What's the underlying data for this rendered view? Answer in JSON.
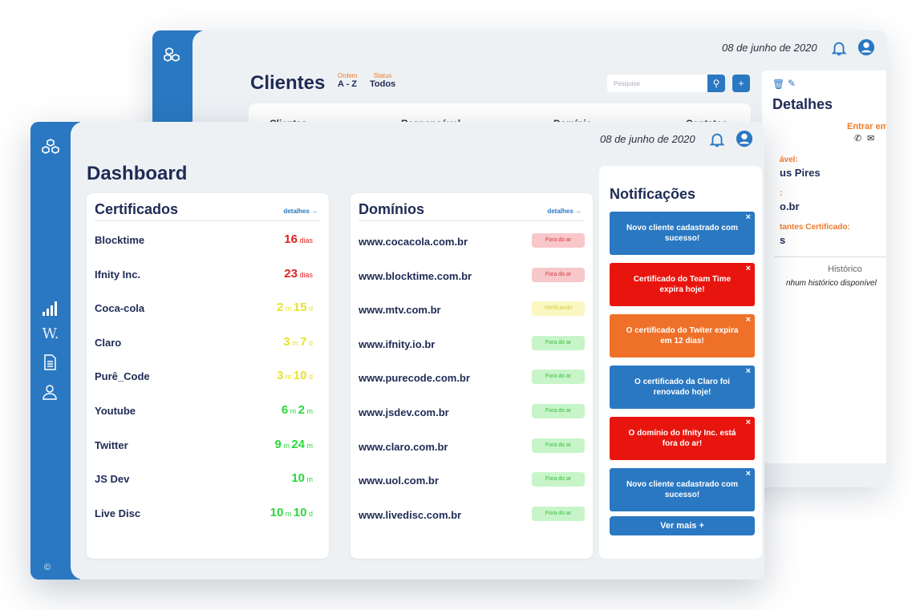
{
  "back": {
    "date": "08 de junho de 2020",
    "title": "Clientes",
    "order_label": "Ordem",
    "order_value": "A - Z",
    "status_label": "Status",
    "status_value": "Todos",
    "search_placeholder": "Pesquise",
    "table_headers": [
      "Clientes",
      "Responsável",
      "Domínio",
      "Contatos"
    ],
    "details": {
      "title": "Detalhes",
      "contact": "Entrar em contato",
      "resp_label": "ável:",
      "resp_value": "us Pires",
      "domain_label": ":",
      "domain_value": "o.br",
      "remaining_label": "tantes Certificado:",
      "remaining_value": "s",
      "history_label": "Histórico",
      "history_empty": "nhum histórico disponível"
    }
  },
  "front": {
    "date": "08 de junho de 2020",
    "title": "Dashboard",
    "copyright": "©",
    "certificates": {
      "title": "Certificados",
      "link": "detalhes →",
      "rows": [
        {
          "name": "Blocktime",
          "parts": [
            [
              "16",
              " dias"
            ]
          ],
          "color": "#e0231f"
        },
        {
          "name": "Ifnity Inc.",
          "parts": [
            [
              "23",
              " dias"
            ]
          ],
          "color": "#e0231f"
        },
        {
          "name": "Coca-cola",
          "parts": [
            [
              "2",
              " m "
            ],
            [
              "15",
              " d"
            ]
          ],
          "color": "#e9e22a"
        },
        {
          "name": "Claro",
          "parts": [
            [
              "3",
              " m "
            ],
            [
              "7",
              " d"
            ]
          ],
          "color": "#e9e22a"
        },
        {
          "name": "Purê_Code",
          "parts": [
            [
              "3",
              " m "
            ],
            [
              "10",
              " d"
            ]
          ],
          "color": "#e9e22a"
        },
        {
          "name": "Youtube",
          "parts": [
            [
              "6",
              " m "
            ],
            [
              "2",
              " m"
            ]
          ],
          "color": "#2bd83a"
        },
        {
          "name": "Twitter",
          "parts": [
            [
              "9",
              " m "
            ],
            [
              "24",
              " m"
            ]
          ],
          "color": "#2bd83a"
        },
        {
          "name": "JS Dev",
          "parts": [
            [
              "10",
              " m"
            ]
          ],
          "color": "#2bd83a"
        },
        {
          "name": "Live Disc",
          "parts": [
            [
              "10",
              " m "
            ],
            [
              "10",
              " d"
            ]
          ],
          "color": "#2bd83a"
        }
      ]
    },
    "domains": {
      "title": "Domínios",
      "link": "detalhes →",
      "rows": [
        {
          "name": "www.cocacola.com.br",
          "status": "Fora do ar",
          "kind": "red"
        },
        {
          "name": "www.blocktime.com.br",
          "status": "Fora do ar",
          "kind": "red"
        },
        {
          "name": "www.mtv.com.br",
          "status": "Verificando",
          "kind": "yellow"
        },
        {
          "name": "www.ifnity.io.br",
          "status": "Fora do ar",
          "kind": "green"
        },
        {
          "name": "www.purecode.com.br",
          "status": "Fora do ar",
          "kind": "green"
        },
        {
          "name": "www.jsdev.com.br",
          "status": "Fora do ar",
          "kind": "green"
        },
        {
          "name": "www.claro.com.br",
          "status": "Fora do ar",
          "kind": "green"
        },
        {
          "name": "www.uol.com.br",
          "status": "Fora do ar",
          "kind": "green"
        },
        {
          "name": "www.livedisc.com.br",
          "status": "Fora do ar",
          "kind": "green"
        }
      ]
    },
    "notifications": {
      "title": "Notificações",
      "more": "Ver mais  +",
      "items": [
        {
          "text": "Novo cliente cadastrado com sucesso!",
          "color": "blue"
        },
        {
          "text": "Certificado do Team Time expira hoje!",
          "color": "red"
        },
        {
          "text": "O certificado do Twiter expira em 12 dias!",
          "color": "orange"
        },
        {
          "text": "O certificado da Claro foi renovado hoje!",
          "color": "blue"
        },
        {
          "text": "O domínio do Ifnity Inc. está fora do ar!",
          "color": "red"
        },
        {
          "text": "Novo cliente cadastrado com sucesso!",
          "color": "blue"
        }
      ]
    }
  }
}
